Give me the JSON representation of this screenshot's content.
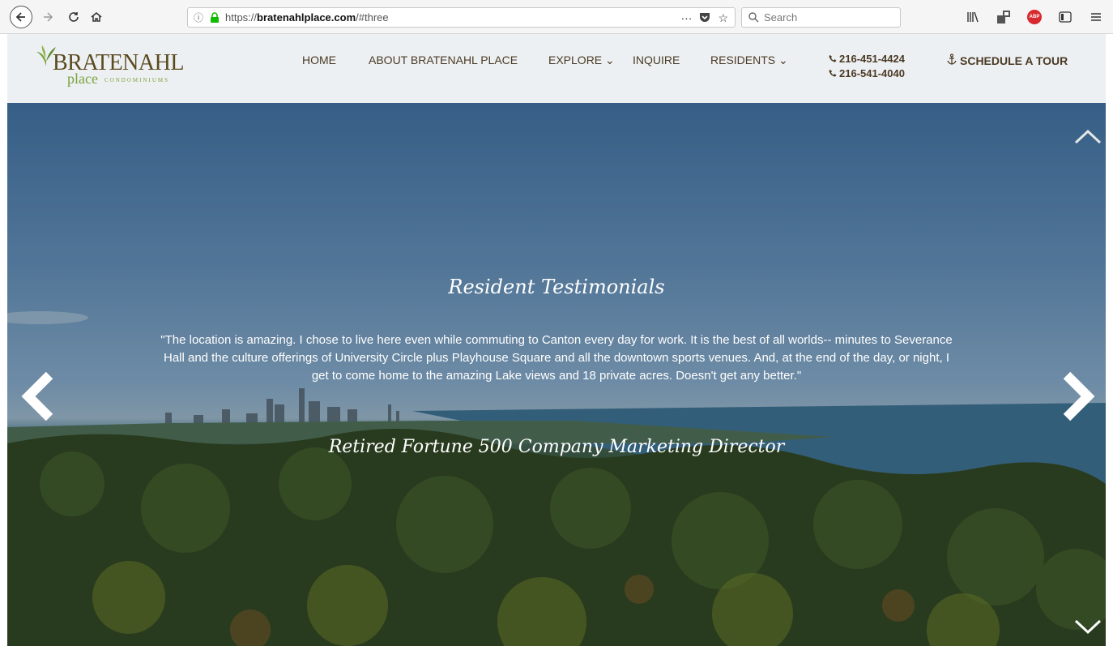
{
  "browser": {
    "url_prefix": "https://",
    "url_host": "bratenahlplace.com",
    "url_path": "/#three",
    "search_placeholder": "Search",
    "page_actions": "···",
    "icons": [
      "back-icon",
      "forward-icon",
      "reload-icon",
      "home-icon",
      "info-icon",
      "lock-icon",
      "pocket-icon",
      "bookmark-star-icon",
      "search-icon",
      "library-icon",
      "extension-icon",
      "adblock-icon",
      "sidebar-icon",
      "menu-icon"
    ],
    "adblock_label": "ABP"
  },
  "site": {
    "logo": {
      "brand": "BRATENAHL",
      "sub": "place",
      "sub_small": "CONDOMINIUMS"
    },
    "nav": [
      {
        "label": "HOME"
      },
      {
        "label": "ABOUT BRATENAHL PLACE"
      },
      {
        "label": "EXPLORE ⌄"
      },
      {
        "label": "INQUIRE"
      },
      {
        "label": "RESIDENTS ⌄"
      }
    ],
    "phones": [
      "216-451-4424",
      "216-541-4040"
    ],
    "tour_label": "SCHEDULE A TOUR"
  },
  "hero": {
    "title": "Resident Testimonials",
    "quote": "\"The location is amazing. I chose to live here even while commuting to Canton every day for work. It is the best of all worlds-- minutes to Severance Hall and the culture offerings of University Circle plus Playhouse Square and all the downtown sports venues. And, at the end of the day, or night, I get to come home to the amazing Lake views and 18 private acres. Doesn't get any better.\"",
    "author": "Retired Fortune 500 Company Marketing Director"
  },
  "colors": {
    "nav_text": "#4a3a24",
    "header_bg": "#edf0f3",
    "logo_brown": "#5a4a1e",
    "logo_green": "#7aa23a"
  }
}
